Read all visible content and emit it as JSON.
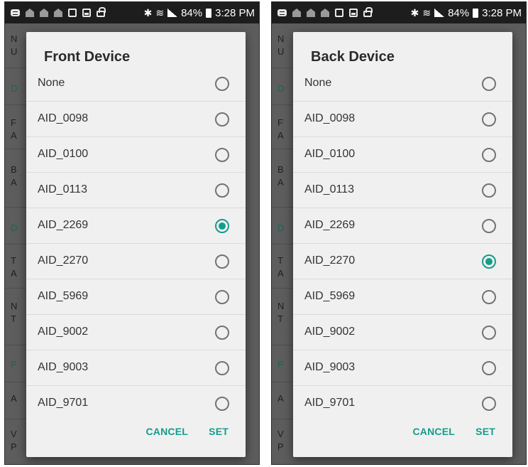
{
  "status_bar": {
    "battery": "84%",
    "time": "3:28 PM"
  },
  "accent_color": "#149d8a",
  "background_letters": [
    {
      "letter": "N",
      "accent": false
    },
    {
      "letter": "U",
      "accent": false
    },
    {
      "letter": "D",
      "accent": true
    },
    {
      "letter": "F",
      "accent": false
    },
    {
      "letter": "A",
      "accent": false
    },
    {
      "letter": "B",
      "accent": false
    },
    {
      "letter": "A",
      "accent": false
    },
    {
      "letter": "D",
      "accent": true
    },
    {
      "letter": "T",
      "accent": false
    },
    {
      "letter": "A",
      "accent": false
    },
    {
      "letter": "N",
      "accent": false
    },
    {
      "letter": "T",
      "accent": false
    },
    {
      "letter": "P",
      "accent": true
    },
    {
      "letter": "A",
      "accent": false
    },
    {
      "letter": "V",
      "accent": false
    },
    {
      "letter": "P",
      "accent": false
    }
  ],
  "dialogs": [
    {
      "title": "Front Device",
      "options": [
        {
          "label": "None",
          "selected": false
        },
        {
          "label": "AID_0098",
          "selected": false
        },
        {
          "label": "AID_0100",
          "selected": false
        },
        {
          "label": "AID_0113",
          "selected": false
        },
        {
          "label": "AID_2269",
          "selected": true
        },
        {
          "label": "AID_2270",
          "selected": false
        },
        {
          "label": "AID_5969",
          "selected": false
        },
        {
          "label": "AID_9002",
          "selected": false
        },
        {
          "label": "AID_9003",
          "selected": false
        },
        {
          "label": "AID_9701",
          "selected": false
        }
      ],
      "cancel_label": "CANCEL",
      "set_label": "SET"
    },
    {
      "title": "Back Device",
      "options": [
        {
          "label": "None",
          "selected": false
        },
        {
          "label": "AID_0098",
          "selected": false
        },
        {
          "label": "AID_0100",
          "selected": false
        },
        {
          "label": "AID_0113",
          "selected": false
        },
        {
          "label": "AID_2269",
          "selected": false
        },
        {
          "label": "AID_2270",
          "selected": true
        },
        {
          "label": "AID_5969",
          "selected": false
        },
        {
          "label": "AID_9002",
          "selected": false
        },
        {
          "label": "AID_9003",
          "selected": false
        },
        {
          "label": "AID_9701",
          "selected": false
        }
      ],
      "cancel_label": "CANCEL",
      "set_label": "SET"
    }
  ]
}
